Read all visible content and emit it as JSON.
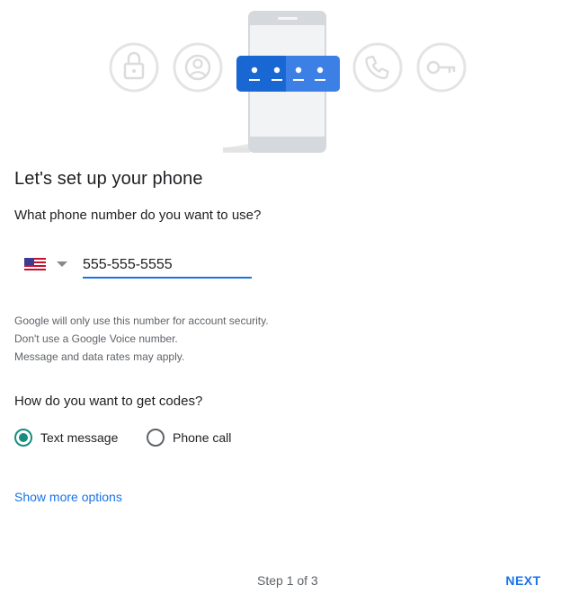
{
  "header": {
    "illustration_icons": [
      "lock-icon",
      "account-icon",
      "phone-code-icon",
      "phone-call-icon",
      "key-icon"
    ]
  },
  "setup": {
    "title": "Let's set up your phone",
    "question": "What phone number do you want to use?",
    "country_flag": "us-flag-icon",
    "phone_value": "555-555-5555",
    "notes": [
      "Google will only use this number for account security.",
      "Don't use a Google Voice number.",
      "Message and data rates may apply."
    ]
  },
  "codes": {
    "question": "How do you want to get codes?",
    "options": [
      {
        "label": "Text message",
        "selected": true
      },
      {
        "label": "Phone call",
        "selected": false
      }
    ]
  },
  "more_options_label": "Show more options",
  "footer": {
    "step_text": "Step 1 of 3",
    "next_label": "NEXT"
  },
  "colors": {
    "accent": "#1a73e8",
    "radio_selected": "#188d80",
    "illustration_blue": "#1967d2"
  }
}
